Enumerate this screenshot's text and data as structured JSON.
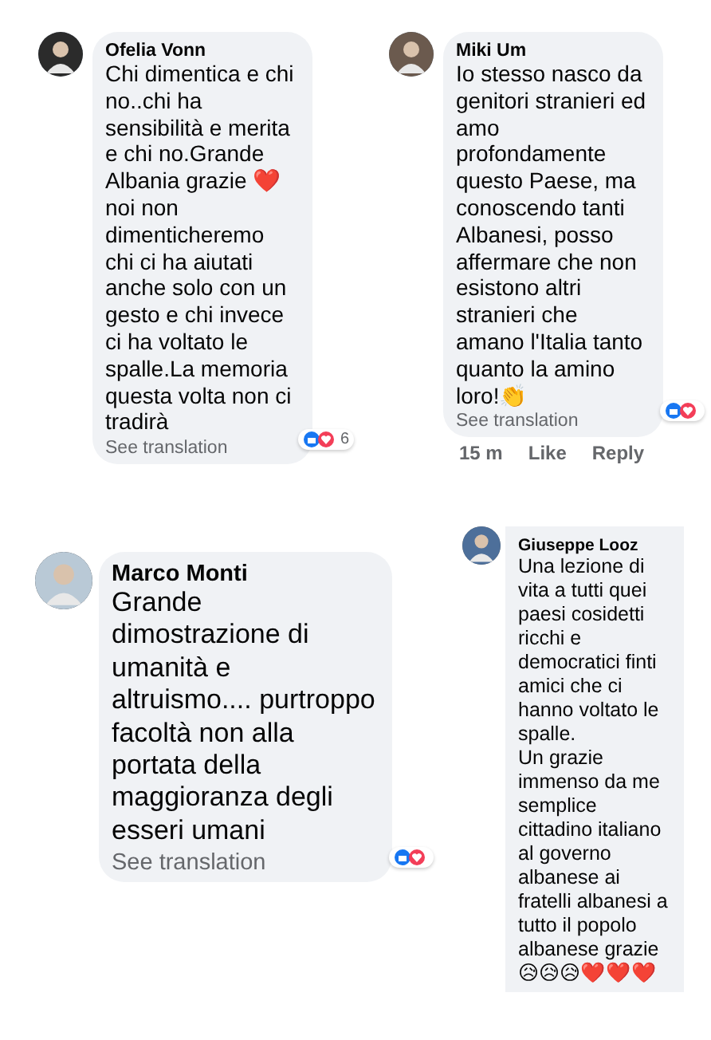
{
  "comments": [
    {
      "author": "Ofelia Vonn",
      "text": "Chi dimentica e chi no..chi ha sensibilità e merita e chi no.Grande Albania grazie ❤️ noi non dimenticheremo chi ci ha aiutati anche solo con un gesto e chi invece ci ha voltato le spalle.La memoria questa volta non ci tradirà",
      "translation": "See translation",
      "reaction_count": "6"
    },
    {
      "author": "Miki Um",
      "text": "Io stesso nasco da genitori stranieri ed amo profondamente questo Paese, ma conoscendo tanti Albanesi, posso affermare che non esistono altri stranieri che amano l'Italia tanto quanto la amino loro!👏",
      "translation": "See translation",
      "footer": [
        "15 m",
        "Like",
        "Reply"
      ]
    },
    {
      "author": "Marco Monti",
      "text": "Grande dimostrazione di umanità e altruismo.... purtroppo facoltà non alla portata della maggioranza degli esseri umani",
      "translation": "See translation"
    },
    {
      "author": "Giuseppe Looz",
      "text": "Una lezione di vita a tutti quei paesi cosidetti ricchi e democratici finti amici che ci hanno voltato le spalle.\nUn grazie immenso da me semplice cittadino italiano al governo albanese ai fratelli albanesi a tutto il popolo albanese grazie 😥😥😥❤️❤️❤️"
    }
  ]
}
